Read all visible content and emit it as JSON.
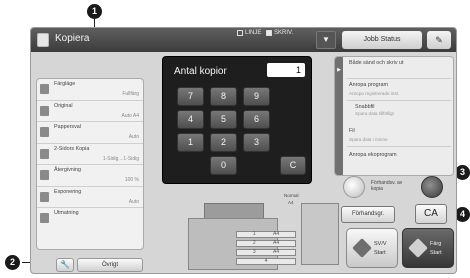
{
  "titlebar": {
    "app_title": "Kopiera",
    "checkbox_linje": "LINJE",
    "checkbox_skriv": "SKRIV.",
    "job_status": "Jobb Status",
    "dropdown_glyph": "▼",
    "settings_glyph": "✎"
  },
  "settings": [
    {
      "label": "Färgläge",
      "value": "Fullfärg",
      "icon": "color-mode-icon"
    },
    {
      "label": "Original",
      "value": "Auto A4",
      "icon": "original-icon"
    },
    {
      "label": "Pappersval",
      "value": "Auto",
      "icon": "paper-icon"
    },
    {
      "label": "2-Sidors Kopia",
      "value": "1-Sidig→1-Sidig",
      "icon": "duplex-icon"
    },
    {
      "label": "Återgivning",
      "value": "100 %",
      "icon": "zoom-icon"
    },
    {
      "label": "Exponering",
      "value": "Auto",
      "icon": "exposure-icon"
    },
    {
      "label": "Utmatning",
      "value": "",
      "icon": "output-icon"
    }
  ],
  "bottom_left": {
    "wrench_glyph": "🔧",
    "ovrigt_label": "Övrigt"
  },
  "keypad": {
    "title": "Antal kopior",
    "count": "1",
    "keys": [
      "7",
      "8",
      "9",
      "4",
      "5",
      "6",
      "1",
      "2",
      "3",
      "0",
      "C"
    ]
  },
  "machine": {
    "normal_label": "Normal",
    "a4_label": "A4",
    "tray_labels": [
      "1",
      "2",
      "3",
      "4"
    ],
    "paper_sizes": [
      "A4",
      "A4",
      "A4"
    ]
  },
  "right_panel": {
    "handle_glyph": "▶",
    "items": [
      {
        "title": "Både sänd och skriv ut",
        "sub": ""
      },
      {
        "title": "Anropa program",
        "sub": "Anropa registrerade inst."
      },
      {
        "title": "Fil",
        "sub": "Spara data i minne"
      },
      {
        "title": "Anropa ekoprogram",
        "sub": ""
      }
    ],
    "sub_item": {
      "title": "Snabbfil",
      "sub": "Spara data tillfälligt"
    }
  },
  "preview_area": {
    "label": "Förhandsv. av kopia"
  },
  "buttons": {
    "preview": "Förhandsgr.",
    "ca": "CA",
    "start_bw_line1": "SV/V",
    "start_bw_line2": "Start",
    "start_color_line1": "Färg",
    "start_color_line2": "Start"
  },
  "callouts": [
    "1",
    "2",
    "3",
    "4"
  ]
}
